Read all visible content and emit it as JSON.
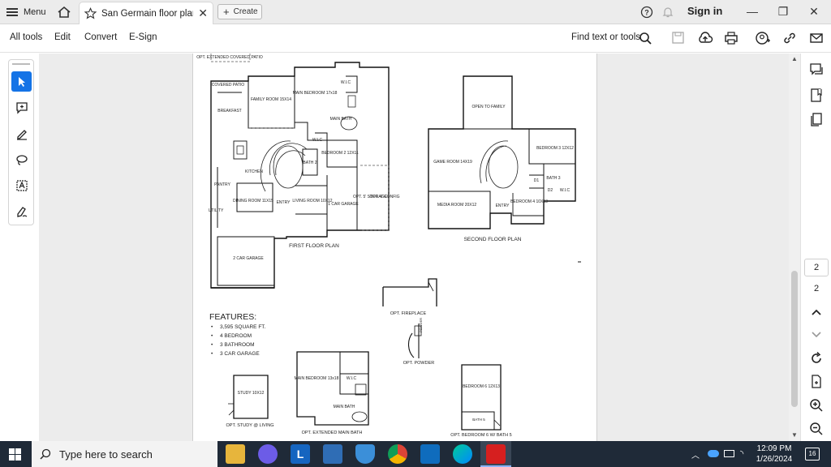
{
  "tabbar": {
    "menu_label": "Menu",
    "tab_title": "San Germain floor plan...",
    "create_label": "Create",
    "signin_label": "Sign in"
  },
  "toolbar": {
    "items": [
      "All tools",
      "Edit",
      "Convert",
      "E-Sign"
    ],
    "find_label": "Find text or tools"
  },
  "document": {
    "first_floor": {
      "caption": "FIRST FLOOR PLAN",
      "rooms": [
        "OPT. EXTENDED COVERED PATIO",
        "COVERED PATIO",
        "BREAKFAST",
        "FAMILY ROOM 15X14",
        "MAIN BEDROOM 17x18",
        "W.I.C",
        "MAIN BATH",
        "W.I.C",
        "BEDROOM 2 12X11",
        "BATH 2",
        "KITCHEN",
        "DINING ROOM 11X15",
        "ENTRY",
        "LIVING ROOM 10X12",
        "1 CAR GARAGE",
        "UTILITY",
        "PANTRY",
        "2 CAR GARAGE",
        "OPT. 5' STORAGE",
        "OPT. 4' CONFIG"
      ]
    },
    "second_floor": {
      "caption": "SECOND FLOOR PLAN",
      "rooms": [
        "OPEN TO FAMILY",
        "BEDROOM 3 12X12",
        "GAME ROOM 14X19",
        "D1",
        "BATH 3",
        "D2",
        "W.I.C",
        "MEDIA ROOM 20X12",
        "ENTRY",
        "BEDROOM 4 10X13"
      ]
    },
    "features_title": "FEATURES:",
    "features": [
      "3,595 SQUARE FT.",
      "4 BEDROOM",
      "3 BATHROOM",
      "3 CAR GARAGE"
    ],
    "options": {
      "fireplace": "OPT. FIREPLACE",
      "powder": "OPT. POWDER",
      "powder_room": "POWDER",
      "study": "OPT. STUDY @ LIVING",
      "study_room": "STUDY 10X12",
      "ext_bath": "OPT. EXTENDED MAIN BATH",
      "ext_bed": "MAIN BEDROOM 13x18",
      "ext_wic": "W.I.C",
      "ext_bathroom": "MAIN BATH",
      "bed6": "OPT. BEDROOM 6 W/ BATH 5",
      "bed6_room": "BEDROOM 6 12X13",
      "bath5": "BATH 5"
    }
  },
  "pagination": {
    "current_page": "2",
    "total_pages": "2"
  },
  "taskbar": {
    "search_placeholder": "Type here to search",
    "time": "12:09 PM",
    "date": "1/26/2024",
    "notification_count": "16"
  }
}
